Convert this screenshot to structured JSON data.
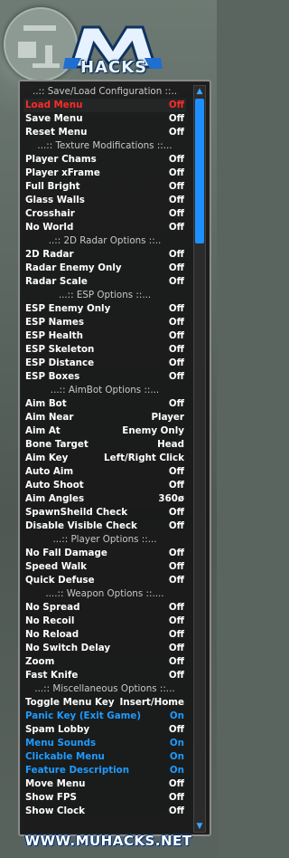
{
  "logo": {
    "text": "HACKS",
    "letter": "M"
  },
  "menu": {
    "rows": [
      {
        "type": "header",
        "label": "..:: Save/Load Configuration ::.."
      },
      {
        "type": "item",
        "label": "Load Menu",
        "value": "Off",
        "selected": true
      },
      {
        "type": "item",
        "label": "Save Menu",
        "value": "Off"
      },
      {
        "type": "item",
        "label": "Reset Menu",
        "value": "Off"
      },
      {
        "type": "header",
        "label": "...:: Texture Modifications ::..."
      },
      {
        "type": "item",
        "label": "Player Chams",
        "value": "Off"
      },
      {
        "type": "item",
        "label": "Player xFrame",
        "value": "Off"
      },
      {
        "type": "item",
        "label": "Full Bright",
        "value": "Off"
      },
      {
        "type": "item",
        "label": "Glass Walls",
        "value": "Off"
      },
      {
        "type": "item",
        "label": "Crosshair",
        "value": "Off"
      },
      {
        "type": "item",
        "label": "No World",
        "value": "Off"
      },
      {
        "type": "header",
        "label": "..:: 2D Radar Options ::.."
      },
      {
        "type": "item",
        "label": "2D Radar",
        "value": "Off"
      },
      {
        "type": "item",
        "label": "Radar Enemy Only",
        "value": "Off"
      },
      {
        "type": "item",
        "label": "Radar Scale",
        "value": "Off"
      },
      {
        "type": "header",
        "label": "...:: ESP Options ::..."
      },
      {
        "type": "item",
        "label": "ESP Enemy Only",
        "value": "Off"
      },
      {
        "type": "item",
        "label": "ESP Names",
        "value": "Off"
      },
      {
        "type": "item",
        "label": "ESP Health",
        "value": "Off"
      },
      {
        "type": "item",
        "label": "ESP Skeleton",
        "value": "Off"
      },
      {
        "type": "item",
        "label": "ESP Distance",
        "value": "Off"
      },
      {
        "type": "item",
        "label": "ESP Boxes",
        "value": "Off"
      },
      {
        "type": "header",
        "label": "...:: AimBot Options ::..."
      },
      {
        "type": "item",
        "label": "Aim Bot",
        "value": "Off"
      },
      {
        "type": "item",
        "label": "Aim Near",
        "value": "Player"
      },
      {
        "type": "item",
        "label": "Aim At",
        "value": "Enemy Only"
      },
      {
        "type": "item",
        "label": "Bone Target",
        "value": "Head"
      },
      {
        "type": "item",
        "label": "Aim Key",
        "value": "Left/Right Click"
      },
      {
        "type": "item",
        "label": "Auto Aim",
        "value": "Off"
      },
      {
        "type": "item",
        "label": "Auto Shoot",
        "value": "Off"
      },
      {
        "type": "item",
        "label": "Aim Angles",
        "value": "360ø"
      },
      {
        "type": "item",
        "label": "SpawnSheild Check",
        "value": "Off"
      },
      {
        "type": "item",
        "label": "Disable Visible Check",
        "value": "Off"
      },
      {
        "type": "header",
        "label": "...:: Player Options ::..."
      },
      {
        "type": "item",
        "label": "No Fall Damage",
        "value": "Off"
      },
      {
        "type": "item",
        "label": "Speed Walk",
        "value": "Off"
      },
      {
        "type": "item",
        "label": "Quick Defuse",
        "value": "Off"
      },
      {
        "type": "header",
        "label": "....:: Weapon Options ::...."
      },
      {
        "type": "item",
        "label": "No Spread",
        "value": "Off"
      },
      {
        "type": "item",
        "label": "No Recoil",
        "value": "Off"
      },
      {
        "type": "item",
        "label": "No Reload",
        "value": "Off"
      },
      {
        "type": "item",
        "label": "No Switch Delay",
        "value": "Off"
      },
      {
        "type": "item",
        "label": "Zoom",
        "value": "Off"
      },
      {
        "type": "item",
        "label": "Fast Knife",
        "value": "Off"
      },
      {
        "type": "header",
        "label": "...:: Miscellaneous Options ::..."
      },
      {
        "type": "item",
        "label": "Toggle Menu Key",
        "value": "Insert/Home"
      },
      {
        "type": "item",
        "label": "Panic Key (Exit Game)",
        "value": "On",
        "on": true,
        "cyan": true
      },
      {
        "type": "item",
        "label": "Spam Lobby",
        "value": "Off"
      },
      {
        "type": "item",
        "label": "Menu Sounds",
        "value": "On",
        "on": true,
        "cyan": true
      },
      {
        "type": "item",
        "label": "Clickable Menu",
        "value": "On",
        "on": true,
        "cyan": true
      },
      {
        "type": "item",
        "label": "Feature Description",
        "value": "On",
        "on": true,
        "cyan": true
      },
      {
        "type": "item",
        "label": "Move Menu",
        "value": "Off"
      },
      {
        "type": "item",
        "label": "Show FPS",
        "value": "Off"
      },
      {
        "type": "item",
        "label": "Show Clock",
        "value": "Off"
      }
    ],
    "scroll": {
      "up_icon": "chevron-up",
      "down_icon": "chevron-down"
    }
  },
  "footer": {
    "url": "WWW.MUHACKS.NET"
  },
  "colors": {
    "selected": "#ff2a2a",
    "on": "#1e9bff",
    "scroll_thumb": "#1e8fff"
  }
}
